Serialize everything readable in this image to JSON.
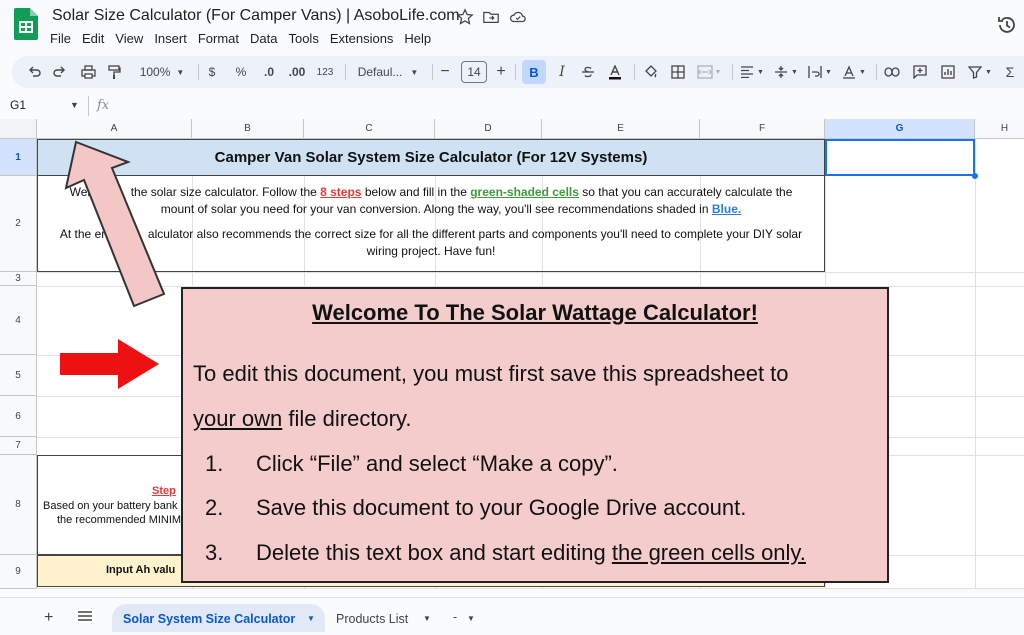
{
  "app": {
    "title": "Solar Size Calculator (For Camper Vans) | AsoboLife.com",
    "menus": [
      "File",
      "Edit",
      "View",
      "Insert",
      "Format",
      "Data",
      "Tools",
      "Extensions",
      "Help"
    ]
  },
  "toolbar": {
    "zoom": "100%",
    "currency": "$",
    "percent": "%",
    "dec_decrease": ".0",
    "dec_increase": ".00",
    "number_format": "123",
    "font": "Defaul...",
    "font_size": "14",
    "bold": "B",
    "italic": "I"
  },
  "formula_bar": {
    "cell_ref": "G1",
    "fx": "fx",
    "value": ""
  },
  "grid": {
    "columns": [
      "A",
      "B",
      "C",
      "D",
      "E",
      "F",
      "G",
      "H"
    ],
    "selected_column": "G",
    "rows": [
      "1",
      "2",
      "3",
      "4",
      "5",
      "6",
      "7",
      "8",
      "9"
    ],
    "selected_row": "1",
    "row1_title": "Camper Van Solar System Size Calculator (For 12V Systems)",
    "row2": {
      "l1a": "Welco",
      "l1b": "the solar size calculator. Follow the ",
      "steps": "8 steps",
      "l1c": " below and fill in the ",
      "green": "green-shaded cells",
      "l1d": " so that you can accurately calculate the",
      "l2a": "mount of solar you need for your van conversion. Along the way, you'll see recommendations shaded in ",
      "blue": "Blue.",
      "l3a": "At the end,",
      "l3b": "alculator also recommends the correct size for all the different parts and components you'll need to complete your DIY solar",
      "l4": "wiring project. Have fun!"
    },
    "row8": {
      "step": "Step",
      "line1": "Based on your battery bank",
      "line2": "the recommended MINIM"
    },
    "row9": {
      "label": "Input Ah valu"
    }
  },
  "textbox": {
    "title": "Welcome To The Solar Wattage Calculator!",
    "p1": "To edit this document, you must first save this spreadsheet to",
    "p2_underlined": "your own",
    "p2_rest": " file directory.",
    "items": [
      {
        "num": "1.",
        "text": "Click “File” and select “Make a copy”."
      },
      {
        "num": "2.",
        "text": "Save this document to your Google Drive account."
      },
      {
        "num": "3.",
        "text": "Delete this text box and start editing ",
        "underlined": "the green cells only."
      }
    ]
  },
  "sheets": {
    "add": "+",
    "tabs": [
      {
        "label": "Solar System Size Calculator",
        "active": true
      },
      {
        "label": "Products List",
        "active": false
      },
      {
        "label": "-",
        "active": false
      }
    ]
  },
  "colors": {
    "title_fill": "#cfe2f3",
    "textbox_fill": "#f4cccc",
    "row9_fill": "#fff2cc",
    "selection": "#1a73e8",
    "red_arrow": "#ee1111",
    "pink_arrow": "#f4c7c7"
  }
}
